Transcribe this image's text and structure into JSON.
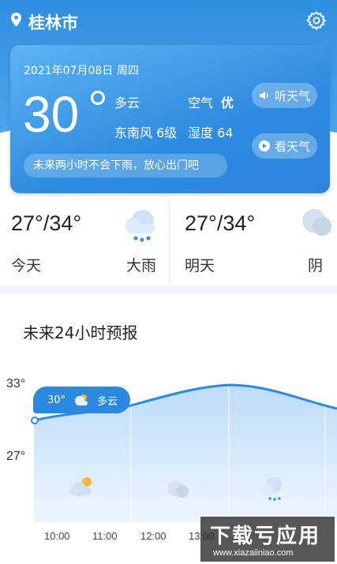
{
  "header": {
    "city": "桂林市"
  },
  "current": {
    "date": "2021年07月08日",
    "weekday": "周四",
    "temperature": "30",
    "condition": "多云",
    "air_label": "空气",
    "air_value": "优",
    "wind": "东南风 6级",
    "humidity": "湿度 64",
    "listen_button": "听天气",
    "watch_button": "看天气",
    "tip": "未来两小时不会下雨，放心出门吧"
  },
  "daily": [
    {
      "day": "今天",
      "temp_range": "27°/34°",
      "condition": "大雨",
      "icon": "rain-cloud-icon"
    },
    {
      "day": "明天",
      "temp_range": "27°/34°",
      "condition": "阴",
      "icon": "overcast-cloud-icon"
    }
  ],
  "forecast": {
    "title": "未来24小时预报",
    "y_high": "33°",
    "y_low": "27°",
    "tooltip_temp": "30°",
    "tooltip_cond": "多云",
    "hours": [
      "10:00",
      "11:00",
      "12:00",
      "13:00"
    ],
    "temps": [
      30,
      31,
      32,
      33,
      33,
      32,
      31
    ]
  },
  "watermark": {
    "main": "下载亏应用",
    "sub": "www.xiazaiiniao.com"
  },
  "colors": {
    "accent": "#2b8ae0",
    "card": "#3a95e6"
  }
}
